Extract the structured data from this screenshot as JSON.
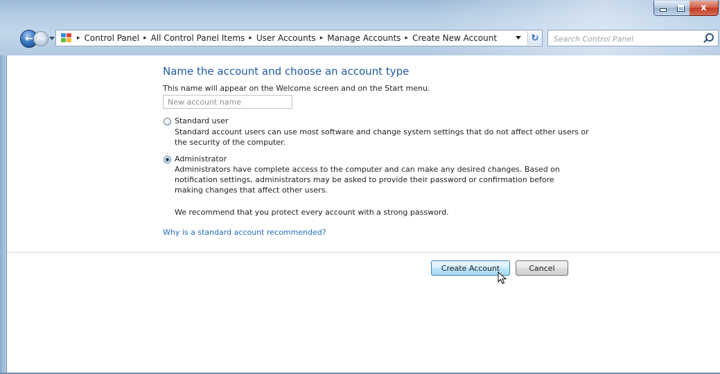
{
  "window": {
    "minimize_label": "",
    "maximize_label": "",
    "close_label": "x"
  },
  "nav": {
    "back_glyph": "←",
    "forward_glyph": "→",
    "refresh_glyph": "↻",
    "breadcrumb": [
      "Control Panel",
      "All Control Panel Items",
      "User Accounts",
      "Manage Accounts",
      "Create New Account"
    ],
    "separator": "▸"
  },
  "search": {
    "placeholder": "Search Control Panel"
  },
  "form": {
    "heading": "Name the account and choose an account type",
    "name_hint": "This name will appear on the Welcome screen and on the Start menu.",
    "name_placeholder": "New account name",
    "options": [
      {
        "label": "Standard user",
        "description_lines": [
          "Standard account users can use most software and change system settings that do not affect other users or",
          "the security of the computer."
        ],
        "selected": false
      },
      {
        "label": "Administrator",
        "description_lines": [
          "Administrators have complete access to the computer and can make any desired changes. Based on",
          "notification settings, administrators may be asked to provide their password or confirmation before",
          "making changes that affect other users."
        ],
        "selected": true
      }
    ],
    "recommendation": "We recommend that you protect every account with a strong password.",
    "help_link": "Why is a standard account recommended?"
  },
  "buttons": {
    "create": "Create Account",
    "cancel": "Cancel"
  },
  "colors": {
    "heading": "#1e5aa3",
    "link": "#1f6dbd",
    "close_button": "#c0391f"
  }
}
